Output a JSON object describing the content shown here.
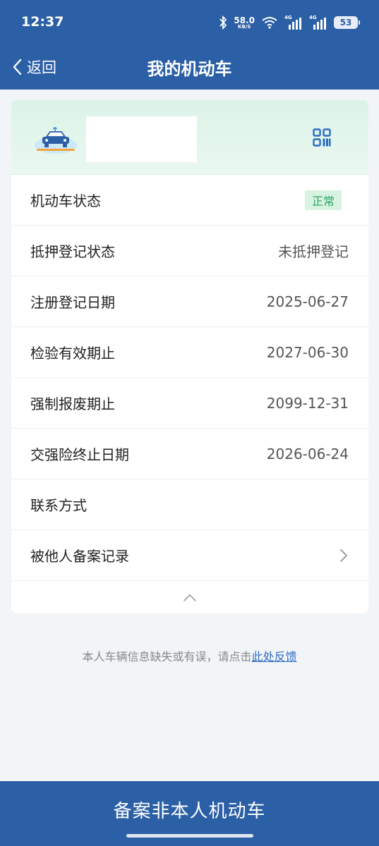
{
  "status_bar": {
    "time": "12:37",
    "net_speed": "58.0",
    "net_unit": "KB/S",
    "signal1_label": "4G",
    "signal2_label": "4G",
    "battery": "53"
  },
  "nav": {
    "back_label": "返回",
    "title": "我的机动车"
  },
  "vehicle": {
    "icon": "car-icon",
    "qr_icon": "qr-code-icon",
    "rows": [
      {
        "label": "机动车状态",
        "value": "正常",
        "type": "badge"
      },
      {
        "label": "抵押登记状态",
        "value": "未抵押登记"
      },
      {
        "label": "注册登记日期",
        "value": "2025-06-27"
      },
      {
        "label": "检验有效期止",
        "value": "2027-06-30"
      },
      {
        "label": "强制报废期止",
        "value": "2099-12-31"
      },
      {
        "label": "交强险终止日期",
        "value": "2026-06-24"
      },
      {
        "label": "联系方式",
        "value": ""
      },
      {
        "label": "被他人备案记录",
        "value": "",
        "type": "link"
      }
    ]
  },
  "feedback": {
    "text": "本人车辆信息缺失或有误，请点击",
    "link": "此处反馈"
  },
  "bottom_button": {
    "label": "备案非本人机动车"
  },
  "colors": {
    "header_blue": "#2b5fa6",
    "badge_green": "#2aa566",
    "link_blue": "#2b6cc4"
  }
}
